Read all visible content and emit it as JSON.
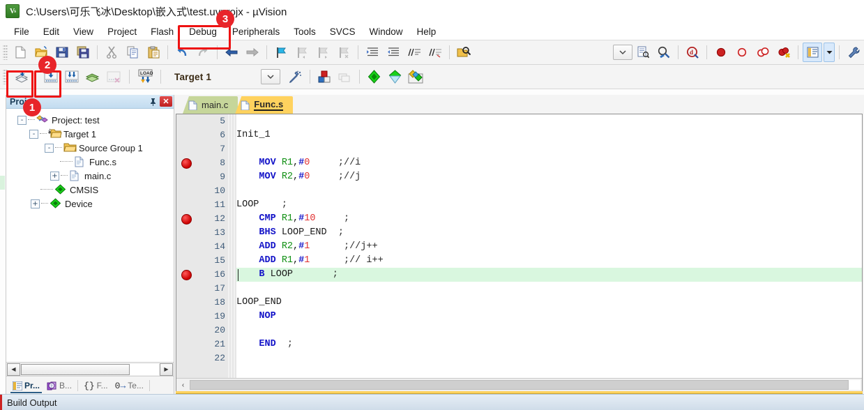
{
  "window": {
    "title": "C:\\Users\\可乐飞冰\\Desktop\\嵌入式\\test.uvprojx - µVision",
    "app_icon": "uvision-icon"
  },
  "menubar": {
    "items": [
      {
        "label": "File"
      },
      {
        "label": "Edit"
      },
      {
        "label": "View"
      },
      {
        "label": "Project"
      },
      {
        "label": "Flash"
      },
      {
        "label": "Debug"
      },
      {
        "label": "Peripherals"
      },
      {
        "label": "Tools"
      },
      {
        "label": "SVCS"
      },
      {
        "label": "Window"
      },
      {
        "label": "Help"
      }
    ]
  },
  "toolbar_main": {
    "buttons": [
      {
        "name": "new-file-icon"
      },
      {
        "name": "open-file-icon"
      },
      {
        "name": "save-icon"
      },
      {
        "name": "save-all-icon"
      },
      {
        "name": "cut-icon"
      },
      {
        "name": "copy-icon"
      },
      {
        "name": "paste-icon"
      },
      {
        "name": "undo-icon"
      },
      {
        "name": "redo-icon"
      },
      {
        "name": "navigate-backward-icon"
      },
      {
        "name": "navigate-forward-icon"
      },
      {
        "name": "insert-bookmark-icon"
      },
      {
        "name": "prev-bookmark-icon"
      },
      {
        "name": "next-bookmark-icon"
      },
      {
        "name": "clear-bookmarks-icon"
      },
      {
        "name": "indent-icon"
      },
      {
        "name": "outdent-icon"
      },
      {
        "name": "comment-icon"
      },
      {
        "name": "uncomment-icon"
      },
      {
        "name": "find-in-files-icon"
      },
      {
        "name": "configure-toolbar-chevron-icon"
      },
      {
        "name": "source-browse-icon"
      },
      {
        "name": "find-icon"
      },
      {
        "name": "start-debug-icon"
      },
      {
        "name": "insert-breakpoint-icon"
      },
      {
        "name": "disable-breakpoint-icon"
      },
      {
        "name": "disable-all-breakpoints-icon"
      },
      {
        "name": "kill-all-breakpoints-icon"
      },
      {
        "name": "window-layout-icon"
      },
      {
        "name": "window-layout-dropdown-icon"
      },
      {
        "name": "configure-icon"
      }
    ]
  },
  "toolbar_build": {
    "buttons": [
      {
        "name": "translate-file-icon"
      },
      {
        "name": "build-target-icon"
      },
      {
        "name": "rebuild-all-icon"
      },
      {
        "name": "batch-build-icon"
      },
      {
        "name": "stop-build-icon"
      },
      {
        "name": "download-icon"
      }
    ],
    "target_value": "Target 1",
    "after_buttons": [
      {
        "name": "target-options-wizard-icon"
      },
      {
        "name": "manage-project-items-icon"
      },
      {
        "name": "multi-project-icon"
      },
      {
        "name": "pack-installer-icon"
      },
      {
        "name": "manage-run-time-environment-icon"
      },
      {
        "name": "software-packs-icon"
      }
    ]
  },
  "project_panel": {
    "title": "Proj",
    "pin_icon": "pin-icon",
    "close_icon": "close-icon",
    "tree": [
      {
        "label": "Project: test",
        "depth": 0,
        "expander": "-",
        "icon": "project-icon"
      },
      {
        "label": "Target 1",
        "depth": 1,
        "expander": "-",
        "icon": "target-folder-icon"
      },
      {
        "label": "Source Group 1",
        "depth": 2,
        "expander": "-",
        "icon": "folder-icon"
      },
      {
        "label": "Func.s",
        "depth": 3,
        "expander": "",
        "icon": "file-icon"
      },
      {
        "label": "main.c",
        "depth": 3,
        "expander": "+",
        "icon": "file-icon"
      },
      {
        "label": "CMSIS",
        "depth": 2,
        "expander": "",
        "icon": "component-icon"
      },
      {
        "label": "Device",
        "depth": 2,
        "expander": "+",
        "icon": "component-icon"
      }
    ],
    "tabs": [
      {
        "label": "Pr...",
        "icon": "project-tab-icon",
        "active": true
      },
      {
        "label": "B...",
        "icon": "books-tab-icon",
        "active": false
      },
      {
        "label": "F...",
        "icon": "functions-tab-icon",
        "active": false
      },
      {
        "label": "Te...",
        "icon": "templates-tab-icon",
        "active": false
      }
    ],
    "scroll_left_arrow": "◀",
    "scroll_right_arrow": "▶"
  },
  "editor": {
    "tabs": [
      {
        "label": "main.c",
        "active": false,
        "icon": "file-icon"
      },
      {
        "label": "Func.s",
        "active": true,
        "icon": "file-icon"
      }
    ],
    "scroll_left_arrow": "‹",
    "first_line": 5,
    "lines": [
      {
        "no": "5",
        "breakpoint": false,
        "highlight": false,
        "tokens": []
      },
      {
        "no": "6",
        "breakpoint": false,
        "highlight": false,
        "tokens": [
          {
            "t": "Init_1",
            "c": "plain"
          }
        ]
      },
      {
        "no": "7",
        "breakpoint": false,
        "highlight": false,
        "tokens": []
      },
      {
        "no": "8",
        "breakpoint": true,
        "highlight": false,
        "tokens": [
          {
            "t": "    ",
            "c": "plain"
          },
          {
            "t": "MOV",
            "c": "kw"
          },
          {
            "t": " ",
            "c": "plain"
          },
          {
            "t": "R1",
            "c": "reg"
          },
          {
            "t": ",",
            "c": "plain"
          },
          {
            "t": "#",
            "c": "hash"
          },
          {
            "t": "0",
            "c": "num"
          },
          {
            "t": "     ",
            "c": "plain"
          },
          {
            "t": ";//i",
            "c": "cmt"
          }
        ]
      },
      {
        "no": "9",
        "breakpoint": false,
        "highlight": false,
        "tokens": [
          {
            "t": "    ",
            "c": "plain"
          },
          {
            "t": "MOV",
            "c": "kw"
          },
          {
            "t": " ",
            "c": "plain"
          },
          {
            "t": "R2",
            "c": "reg"
          },
          {
            "t": ",",
            "c": "plain"
          },
          {
            "t": "#",
            "c": "hash"
          },
          {
            "t": "0",
            "c": "num"
          },
          {
            "t": "     ",
            "c": "plain"
          },
          {
            "t": ";//j",
            "c": "cmt"
          }
        ]
      },
      {
        "no": "10",
        "breakpoint": false,
        "highlight": false,
        "tokens": []
      },
      {
        "no": "11",
        "breakpoint": false,
        "highlight": false,
        "tokens": [
          {
            "t": "LOOP",
            "c": "plain"
          },
          {
            "t": "    ",
            "c": "plain"
          },
          {
            "t": ";",
            "c": "cmt"
          }
        ]
      },
      {
        "no": "12",
        "breakpoint": true,
        "highlight": false,
        "tokens": [
          {
            "t": "    ",
            "c": "plain"
          },
          {
            "t": "CMP",
            "c": "kw"
          },
          {
            "t": " ",
            "c": "plain"
          },
          {
            "t": "R1",
            "c": "reg"
          },
          {
            "t": ",",
            "c": "plain"
          },
          {
            "t": "#",
            "c": "hash"
          },
          {
            "t": "10",
            "c": "num"
          },
          {
            "t": "     ",
            "c": "plain"
          },
          {
            "t": ";",
            "c": "cmt"
          }
        ]
      },
      {
        "no": "13",
        "breakpoint": false,
        "highlight": false,
        "tokens": [
          {
            "t": "    ",
            "c": "plain"
          },
          {
            "t": "BHS",
            "c": "kw"
          },
          {
            "t": " ",
            "c": "plain"
          },
          {
            "t": "LOOP_END",
            "c": "plain"
          },
          {
            "t": "  ",
            "c": "plain"
          },
          {
            "t": ";",
            "c": "cmt"
          }
        ]
      },
      {
        "no": "14",
        "breakpoint": false,
        "highlight": false,
        "tokens": [
          {
            "t": "    ",
            "c": "plain"
          },
          {
            "t": "ADD",
            "c": "kw"
          },
          {
            "t": " ",
            "c": "plain"
          },
          {
            "t": "R2",
            "c": "reg"
          },
          {
            "t": ",",
            "c": "plain"
          },
          {
            "t": "#",
            "c": "hash"
          },
          {
            "t": "1",
            "c": "num"
          },
          {
            "t": "      ",
            "c": "plain"
          },
          {
            "t": ";//j++",
            "c": "cmt"
          }
        ]
      },
      {
        "no": "15",
        "breakpoint": false,
        "highlight": false,
        "tokens": [
          {
            "t": "    ",
            "c": "plain"
          },
          {
            "t": "ADD",
            "c": "kw"
          },
          {
            "t": " ",
            "c": "plain"
          },
          {
            "t": "R1",
            "c": "reg"
          },
          {
            "t": ",",
            "c": "plain"
          },
          {
            "t": "#",
            "c": "hash"
          },
          {
            "t": "1",
            "c": "num"
          },
          {
            "t": "      ",
            "c": "plain"
          },
          {
            "t": ";// i++",
            "c": "cmt"
          }
        ]
      },
      {
        "no": "16",
        "breakpoint": true,
        "highlight": true,
        "tokens": [
          {
            "t": "    ",
            "c": "plain"
          },
          {
            "t": "B",
            "c": "kw"
          },
          {
            "t": " ",
            "c": "plain"
          },
          {
            "t": "LOOP",
            "c": "plain"
          },
          {
            "t": "       ",
            "c": "plain"
          },
          {
            "t": ";",
            "c": "cmt"
          }
        ]
      },
      {
        "no": "17",
        "breakpoint": false,
        "highlight": false,
        "tokens": []
      },
      {
        "no": "18",
        "breakpoint": false,
        "highlight": false,
        "tokens": [
          {
            "t": "LOOP_END",
            "c": "plain"
          }
        ]
      },
      {
        "no": "19",
        "breakpoint": false,
        "highlight": false,
        "tokens": [
          {
            "t": "    ",
            "c": "plain"
          },
          {
            "t": "NOP",
            "c": "kw"
          }
        ]
      },
      {
        "no": "20",
        "breakpoint": false,
        "highlight": false,
        "tokens": []
      },
      {
        "no": "21",
        "breakpoint": false,
        "highlight": false,
        "tokens": [
          {
            "t": "    ",
            "c": "plain"
          },
          {
            "t": "END",
            "c": "kw"
          },
          {
            "t": "  ",
            "c": "plain"
          },
          {
            "t": ";",
            "c": "cmt"
          }
        ]
      },
      {
        "no": "22",
        "breakpoint": false,
        "highlight": false,
        "tokens": []
      }
    ]
  },
  "build_output": {
    "label": "Build Output"
  },
  "annotations": [
    {
      "badge": "1",
      "target": "project-panel-title"
    },
    {
      "badge": "2",
      "target": "build-toolbar-buttons"
    },
    {
      "badge": "3",
      "target": "debug-menu"
    }
  ],
  "colors": {
    "annotation_red": "#e8252a",
    "active_tab": "#ffd25e",
    "inactive_tab": "#c6d69a",
    "highlight_line": "#d9f7df",
    "panel_header": "#c3dcf0"
  }
}
